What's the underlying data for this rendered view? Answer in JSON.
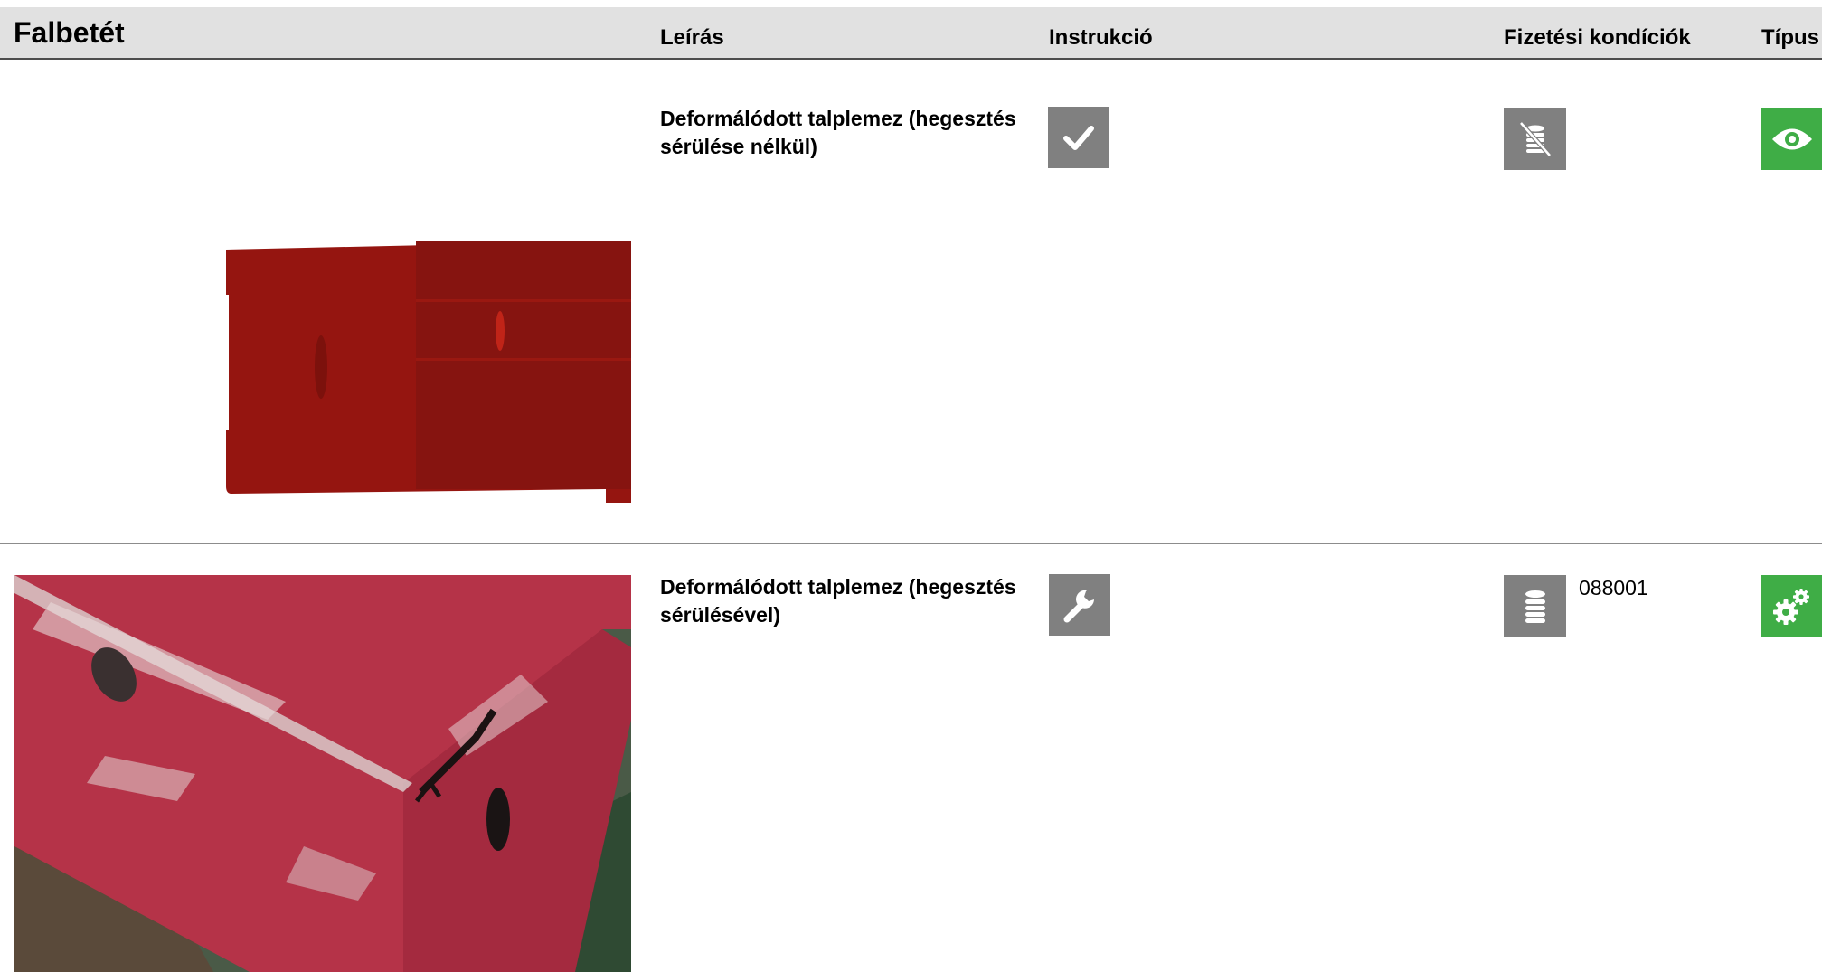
{
  "header": {
    "title": "Falbetét",
    "col_description": "Leírás",
    "col_instruction": "Instrukció",
    "col_payment": "Fizetési kondíciók",
    "col_type": "Típus"
  },
  "rows": [
    {
      "description": "Deformálódott talplemez (hegesztés sérülése nélkül)",
      "instruction_icon": "checkmark-icon",
      "payment_icon": "coins-crossed-icon",
      "payment_code": "",
      "type_icon": "eye-icon",
      "image": "red-panel-render"
    },
    {
      "description": "Deformálódott talplemez (hegesztés sérülésével)",
      "instruction_icon": "wrench-icon",
      "payment_icon": "coins-icon",
      "payment_code": "088001",
      "type_icon": "gears-icon",
      "image": "damaged-red-beam-photo"
    }
  ],
  "colors": {
    "header_bg": "#e1e1e1",
    "icon_gray": "#808080",
    "icon_green": "#3fad46",
    "panel_red": "#8f1510"
  }
}
